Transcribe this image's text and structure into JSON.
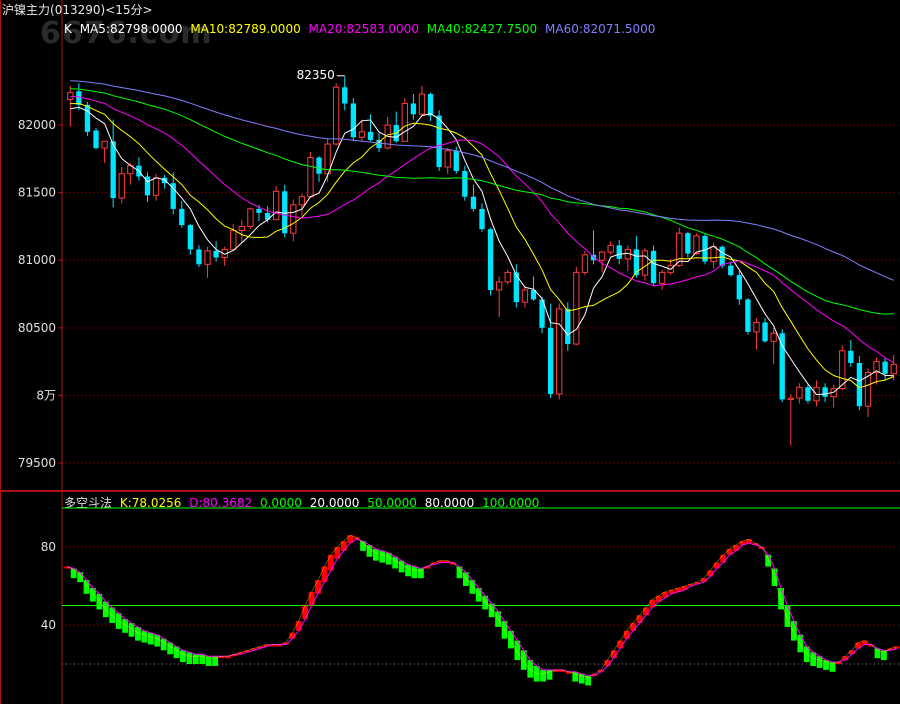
{
  "header": {
    "title": "沪镍主力",
    "code": "(013290)",
    "period": "<15分>",
    "watermark": "6676.com"
  },
  "ma_legend": {
    "k_label": "K",
    "items": [
      {
        "text": "MA5:82798.0000",
        "color": "#ffffff"
      },
      {
        "text": "MA10:82789.0000",
        "color": "#ffff00"
      },
      {
        "text": "MA20:82583.0000",
        "color": "#ff00ff"
      },
      {
        "text": "MA40:82427.7500",
        "color": "#00ff00"
      },
      {
        "text": "MA60:82071.5000",
        "color": "#8080ff"
      }
    ]
  },
  "ind_legend": {
    "name": "多空斗法",
    "items": [
      {
        "text": "K:78.0256",
        "color": "#ffff00"
      },
      {
        "text": "D:80.3682",
        "color": "#ff00ff"
      },
      {
        "text": "0.0000",
        "color": "#00ff00"
      },
      {
        "text": "20.0000",
        "color": "#ffffff"
      },
      {
        "text": "50.0000",
        "color": "#00ff00"
      },
      {
        "text": "80.0000",
        "color": "#ffffff"
      },
      {
        "text": "100.0000",
        "color": "#00ff00"
      }
    ]
  },
  "chart_data": [
    {
      "type": "candlestick",
      "title": "沪镍主力",
      "y_ticks": [
        {
          "label": "82000",
          "value": 82000
        },
        {
          "label": "81500",
          "value": 81500
        },
        {
          "label": "81000",
          "value": 81000
        },
        {
          "label": "80500",
          "value": 80500
        },
        {
          "label": "8万",
          "value": 80000
        },
        {
          "label": "79500",
          "value": 79500
        }
      ],
      "ylim": [
        79300,
        82600
      ],
      "annotation": {
        "label": "82350",
        "value": 82350
      },
      "up_color": "#ff3b3b",
      "down_color": "#00e5ff",
      "ohlc": [
        [
          82190,
          82290,
          81990,
          82240
        ],
        [
          82250,
          82310,
          82110,
          82150
        ],
        [
          82150,
          82170,
          81920,
          81950
        ],
        [
          81960,
          81980,
          81820,
          81830
        ],
        [
          81830,
          81880,
          81720,
          81880
        ],
        [
          81880,
          82040,
          81390,
          81460
        ],
        [
          81460,
          81690,
          81420,
          81640
        ],
        [
          81640,
          81720,
          81560,
          81700
        ],
        [
          81700,
          81760,
          81590,
          81620
        ],
        [
          81620,
          81650,
          81430,
          81480
        ],
        [
          81480,
          81640,
          81440,
          81610
        ],
        [
          81610,
          81630,
          81530,
          81570
        ],
        [
          81570,
          81650,
          81340,
          81380
        ],
        [
          81380,
          81440,
          81240,
          81260
        ],
        [
          81260,
          81270,
          81040,
          81080
        ],
        [
          81080,
          81110,
          80950,
          80970
        ],
        [
          80970,
          81100,
          80870,
          81070
        ],
        [
          81070,
          81140,
          80990,
          81020
        ],
        [
          81020,
          81100,
          80960,
          81080
        ],
        [
          81080,
          81270,
          81070,
          81220
        ],
        [
          81220,
          81300,
          81130,
          81250
        ],
        [
          81250,
          81390,
          81230,
          81380
        ],
        [
          81380,
          81410,
          81290,
          81350
        ],
        [
          81350,
          81400,
          81280,
          81300
        ],
        [
          81300,
          81550,
          81300,
          81510
        ],
        [
          81510,
          81560,
          81170,
          81200
        ],
        [
          81200,
          81450,
          81140,
          81410
        ],
        [
          81410,
          81490,
          81330,
          81470
        ],
        [
          81470,
          81800,
          81460,
          81760
        ],
        [
          81760,
          81770,
          81580,
          81640
        ],
        [
          81640,
          81900,
          81580,
          81860
        ],
        [
          81860,
          82310,
          81850,
          82280
        ],
        [
          82280,
          82360,
          82110,
          82160
        ],
        [
          82160,
          82200,
          81880,
          81910
        ],
        [
          81910,
          82040,
          81880,
          81950
        ],
        [
          81950,
          82080,
          81880,
          81890
        ],
        [
          81890,
          81940,
          81800,
          81830
        ],
        [
          81830,
          82060,
          81820,
          82000
        ],
        [
          82000,
          82100,
          81870,
          81880
        ],
        [
          81880,
          82200,
          81880,
          82160
        ],
        [
          82160,
          82230,
          82040,
          82080
        ],
        [
          82080,
          82290,
          82070,
          82230
        ],
        [
          82230,
          82240,
          82030,
          82070
        ],
        [
          82070,
          82110,
          81660,
          81690
        ],
        [
          81690,
          81830,
          81640,
          81810
        ],
        [
          81810,
          81840,
          81640,
          81660
        ],
        [
          81660,
          81700,
          81440,
          81470
        ],
        [
          81470,
          81560,
          81360,
          81380
        ],
        [
          81380,
          81420,
          81210,
          81230
        ],
        [
          81230,
          81240,
          80740,
          80780
        ],
        [
          80780,
          80880,
          80580,
          80840
        ],
        [
          80840,
          80930,
          80820,
          80910
        ],
        [
          80910,
          80970,
          80650,
          80690
        ],
        [
          80690,
          80810,
          80650,
          80780
        ],
        [
          80780,
          80880,
          80700,
          80710
        ],
        [
          80710,
          80730,
          80460,
          80500
        ],
        [
          80500,
          80680,
          79980,
          80010
        ],
        [
          80010,
          80680,
          79970,
          80640
        ],
        [
          80640,
          80690,
          80330,
          80380
        ],
        [
          80380,
          80950,
          80370,
          80910
        ],
        [
          80910,
          81070,
          80890,
          81040
        ],
        [
          81040,
          81220,
          80970,
          81000
        ],
        [
          81000,
          81070,
          80910,
          81060
        ],
        [
          81060,
          81140,
          81040,
          81110
        ],
        [
          81110,
          81150,
          80970,
          81010
        ],
        [
          81010,
          81110,
          80920,
          81080
        ],
        [
          81080,
          81180,
          80870,
          80890
        ],
        [
          80890,
          81090,
          80850,
          81070
        ],
        [
          81070,
          81110,
          80810,
          80830
        ],
        [
          80830,
          80930,
          80780,
          80910
        ],
        [
          80910,
          81010,
          80890,
          80960
        ],
        [
          80960,
          81240,
          80950,
          81200
        ],
        [
          81200,
          81210,
          81020,
          81050
        ],
        [
          81050,
          81200,
          81040,
          81180
        ],
        [
          81180,
          81200,
          80970,
          80990
        ],
        [
          80990,
          81130,
          80940,
          81100
        ],
        [
          81100,
          81110,
          80940,
          80960
        ],
        [
          80960,
          80990,
          80880,
          80890
        ],
        [
          80890,
          80920,
          80670,
          80710
        ],
        [
          80710,
          80720,
          80450,
          80470
        ],
        [
          80470,
          80570,
          80340,
          80540
        ],
        [
          80540,
          80570,
          80390,
          80400
        ],
        [
          80400,
          80500,
          80230,
          80460
        ],
        [
          80460,
          80490,
          79950,
          79970
        ],
        [
          79970,
          80010,
          79630,
          79980
        ],
        [
          79980,
          80090,
          79940,
          80060
        ],
        [
          80060,
          80080,
          79940,
          79960
        ],
        [
          79960,
          80110,
          79920,
          80060
        ],
        [
          80060,
          80090,
          79950,
          79990
        ],
        [
          79990,
          80080,
          79910,
          80050
        ],
        [
          80050,
          80370,
          80040,
          80330
        ],
        [
          80330,
          80410,
          80210,
          80240
        ],
        [
          80240,
          80290,
          79890,
          79920
        ],
        [
          79920,
          80200,
          79840,
          80170
        ],
        [
          80170,
          80280,
          80080,
          80250
        ],
        [
          80250,
          80280,
          80110,
          80160
        ],
        [
          80160,
          80300,
          80110,
          80230
        ]
      ]
    },
    {
      "type": "bar",
      "title": "多空斗法",
      "y_ticks": [
        {
          "label": "80",
          "value": 80
        },
        {
          "label": "40",
          "value": 40
        }
      ],
      "ylim": [
        0,
        100
      ],
      "reference_lines": [
        20,
        50,
        80,
        100
      ],
      "up_color": "#ff0000",
      "down_color": "#00ff00",
      "k": [
        70,
        68,
        66,
        60,
        56,
        52,
        48,
        45,
        42,
        40,
        38,
        36,
        35,
        34,
        33,
        31,
        29,
        27,
        25,
        24,
        24,
        24,
        23,
        23,
        24,
        24,
        25,
        26,
        27,
        28,
        29,
        30,
        30,
        30,
        31,
        36,
        42,
        50,
        57,
        63,
        70,
        76,
        80,
        83,
        86,
        85,
        82,
        79,
        77,
        76,
        75,
        73,
        71,
        69,
        68,
        68,
        70,
        72,
        73,
        73,
        72,
        68,
        64,
        60,
        56,
        52,
        48,
        43,
        37,
        32,
        26,
        21,
        17,
        15,
        15,
        16,
        17,
        17,
        16,
        15,
        14,
        13,
        15,
        17,
        22,
        27,
        32,
        37,
        41,
        45,
        49,
        53,
        55,
        57,
        58,
        59,
        60,
        61,
        62,
        64,
        68,
        72,
        76,
        79,
        81,
        83,
        84,
        82,
        80,
        74,
        64,
        52,
        43,
        36,
        30,
        25,
        23,
        22,
        21,
        20,
        21,
        24,
        27,
        31,
        32,
        30,
        27,
        26,
        28,
        29
      ],
      "d": [
        70,
        69,
        67,
        63,
        59,
        56,
        52,
        49,
        46,
        43,
        41,
        39,
        37,
        36,
        35,
        33,
        31,
        29,
        27,
        26,
        25,
        25,
        24,
        24,
        24,
        24,
        25,
        25,
        26,
        27,
        28,
        29,
        30,
        30,
        30,
        33,
        37,
        43,
        50,
        56,
        62,
        68,
        74,
        78,
        82,
        84,
        83,
        81,
        79,
        78,
        77,
        75,
        73,
        71,
        70,
        69,
        70,
        71,
        72,
        72,
        72,
        70,
        67,
        63,
        59,
        55,
        51,
        47,
        42,
        37,
        32,
        27,
        22,
        19,
        17,
        17,
        17,
        17,
        16,
        16,
        15,
        14,
        14,
        16,
        19,
        23,
        28,
        33,
        37,
        41,
        45,
        49,
        52,
        54,
        56,
        57,
        58,
        60,
        61,
        62,
        65,
        69,
        72,
        76,
        78,
        81,
        82,
        81,
        80,
        76,
        69,
        59,
        50,
        42,
        35,
        29,
        26,
        24,
        22,
        21,
        21,
        22,
        25,
        28,
        30,
        30,
        28,
        27,
        27,
        28
      ]
    }
  ]
}
